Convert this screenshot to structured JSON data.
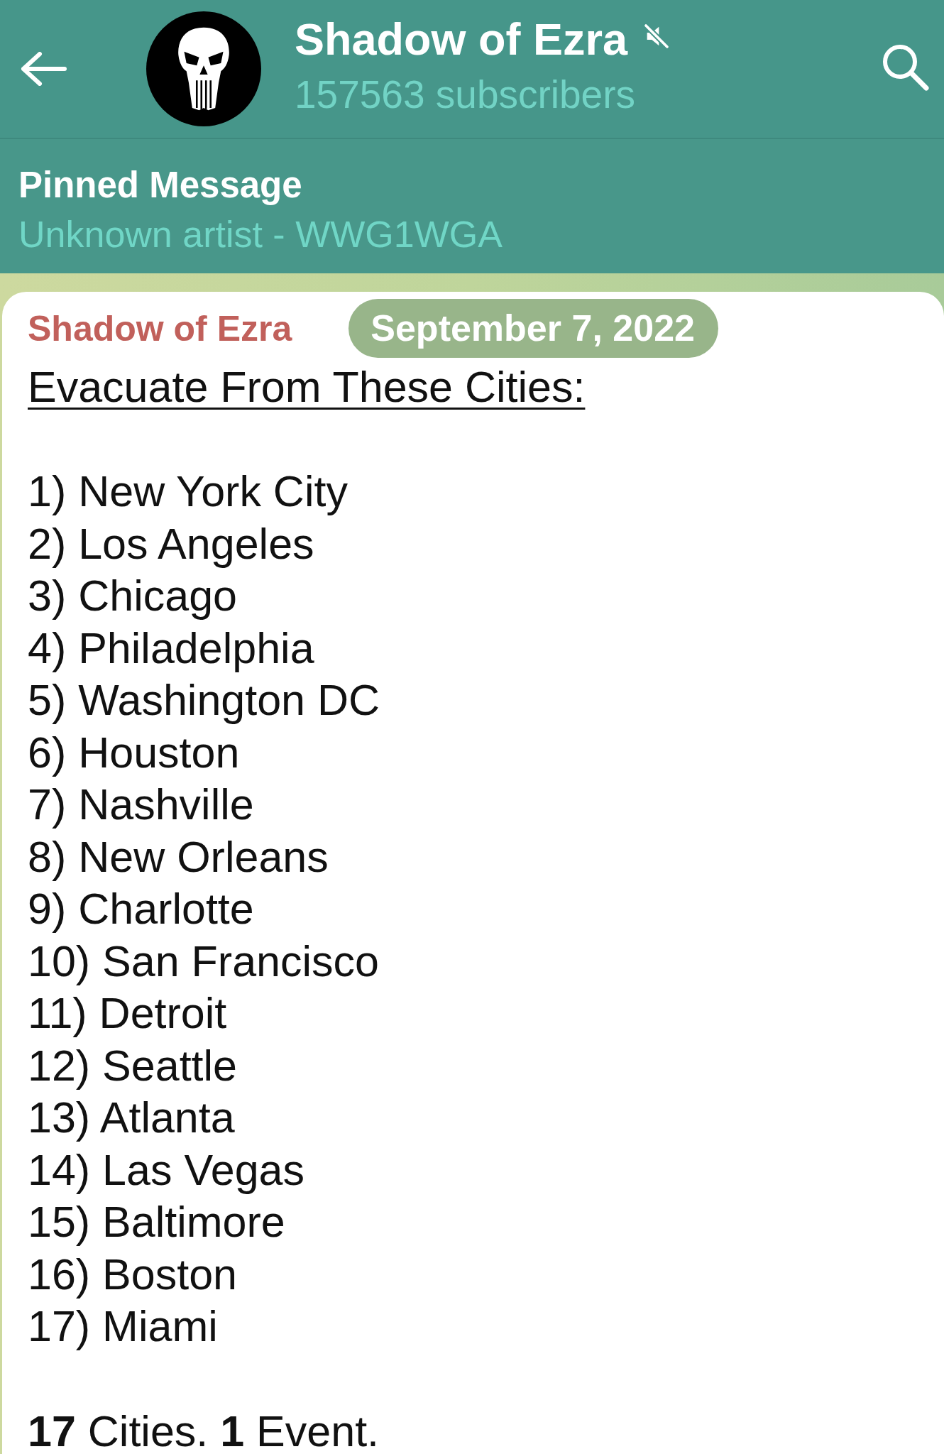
{
  "header": {
    "title": "Shadow of Ezra",
    "muted": true,
    "subscribers": "157563 subscribers"
  },
  "pinned": {
    "label": "Pinned Message",
    "text": "Unknown artist - WWG1WGA"
  },
  "message": {
    "author": "Shadow of Ezra",
    "date": "September 7, 2022",
    "heading": "Evacuate From These Cities:",
    "items": [
      "1) New York City",
      "2) Los Angeles",
      "3) Chicago",
      "4) Philadelphia",
      "5) Washington DC",
      "6) Houston",
      "7) Nashville",
      "8) New Orleans",
      "9) Charlotte",
      "10) San Francisco",
      "11) Detroit",
      "12) Seattle",
      "13) Atlanta",
      "14) Las Vegas",
      "15) Baltimore",
      "16) Boston",
      "17) Miami"
    ],
    "footer": "**17** Cities. **1** Event."
  }
}
